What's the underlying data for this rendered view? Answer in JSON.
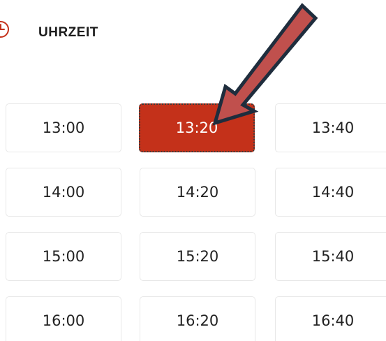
{
  "header": {
    "title": "UHRZEIT",
    "icon": "clock-icon",
    "accent_color": "#c4311a"
  },
  "time_slots": [
    {
      "label": "13:00",
      "selected": false
    },
    {
      "label": "13:20",
      "selected": true
    },
    {
      "label": "13:40",
      "selected": false
    },
    {
      "label": "14:00",
      "selected": false
    },
    {
      "label": "14:20",
      "selected": false
    },
    {
      "label": "14:40",
      "selected": false
    },
    {
      "label": "15:00",
      "selected": false
    },
    {
      "label": "15:20",
      "selected": false
    },
    {
      "label": "15:40",
      "selected": false
    },
    {
      "label": "16:00",
      "selected": false
    },
    {
      "label": "16:20",
      "selected": false
    },
    {
      "label": "16:40",
      "selected": false
    }
  ],
  "selected_color": "#c4311a",
  "annotation_arrow": {
    "fill": "#c0504d",
    "outline": "#1f2d3d"
  }
}
